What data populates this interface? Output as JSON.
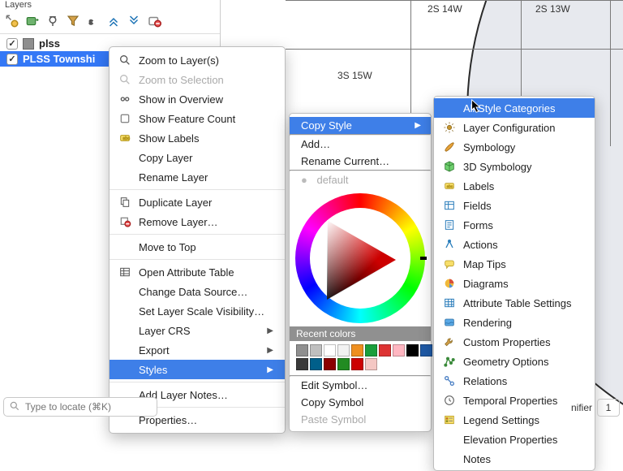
{
  "layers_panel": {
    "title": "Layers",
    "items": [
      {
        "name": "plss",
        "checked": true,
        "selected": false
      },
      {
        "name": "PLSS Townshi",
        "checked": true,
        "selected": true
      }
    ]
  },
  "map_labels": {
    "t2s14w": "2S 14W",
    "t2s13w": "2S 13W",
    "t3s15w": "3S 15W"
  },
  "context_menu": {
    "zoom_to_layers": "Zoom to Layer(s)",
    "zoom_to_selection": "Zoom to Selection",
    "show_in_overview": "Show in Overview",
    "show_feature_count": "Show Feature Count",
    "show_labels": "Show Labels",
    "copy_layer": "Copy Layer",
    "rename_layer": "Rename Layer",
    "duplicate_layer": "Duplicate Layer",
    "remove_layer": "Remove Layer…",
    "move_to_top": "Move to Top",
    "open_attribute_table": "Open Attribute Table",
    "change_data_source": "Change Data Source…",
    "set_layer_scale_vis": "Set Layer Scale Visibility…",
    "layer_crs": "Layer CRS",
    "export": "Export",
    "styles": "Styles",
    "add_layer_notes": "Add Layer Notes…",
    "properties": "Properties…"
  },
  "styles_menu": {
    "copy_style": "Copy Style",
    "add": "Add…",
    "rename_current": "Rename Current…",
    "default": "default",
    "recent_title": "Recent colors",
    "swatches": [
      "#8f8f8f",
      "#bfbfbf",
      "#ffffff",
      "#f2f2f2",
      "#ef8f1f",
      "#1b9e3b",
      "#d33",
      "#ffb6c1",
      "#000000",
      "#1F5AA6",
      "#3a3a3a",
      "#005f8a",
      "#8b0000",
      "#228b22",
      "#cc0000",
      "#f4c7c3"
    ],
    "edit_symbol": "Edit Symbol…",
    "copy_symbol": "Copy Symbol",
    "paste_symbol": "Paste Symbol"
  },
  "categories_menu": {
    "all": "All Style Categories",
    "layer_conf": "Layer Configuration",
    "symbology": "Symbology",
    "symbology3d": "3D Symbology",
    "labels": "Labels",
    "fields": "Fields",
    "forms": "Forms",
    "actions": "Actions",
    "map_tips": "Map Tips",
    "diagrams": "Diagrams",
    "attr_table_settings": "Attribute Table Settings",
    "rendering": "Rendering",
    "custom_props": "Custom Properties",
    "geometry_options": "Geometry Options",
    "relations": "Relations",
    "temporal": "Temporal Properties",
    "legend_settings": "Legend Settings",
    "elevation_props": "Elevation Properties",
    "notes": "Notes"
  },
  "locate": {
    "placeholder": "Type to locate (⌘K)"
  },
  "bottom_right": {
    "magnifier_label": "nifier",
    "magnifier_value": "1"
  }
}
